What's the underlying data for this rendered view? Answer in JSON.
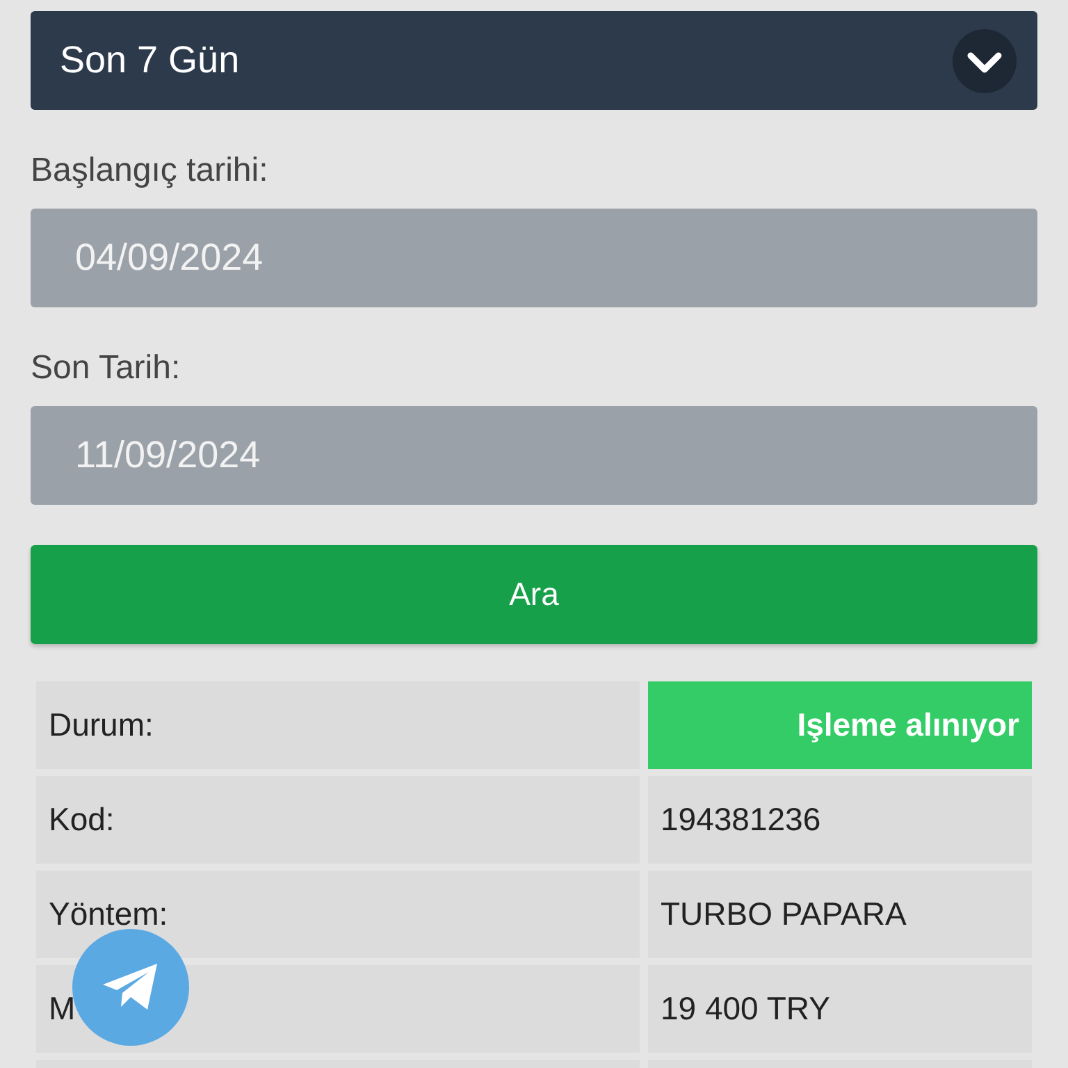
{
  "period_select": {
    "value": "Son 7 Gün"
  },
  "start_date": {
    "label": "Başlangıç tarihi:",
    "value": "04/09/2024"
  },
  "end_date": {
    "label": "Son Tarih:",
    "value": "11/09/2024"
  },
  "search_button": "Ara",
  "details": [
    {
      "label": "Durum:",
      "value": "Işleme alınıyor",
      "kind": "status"
    },
    {
      "label": "Kod:",
      "value": "194381236",
      "kind": "text"
    },
    {
      "label": "Yöntem:",
      "value": "TURBO PAPARA",
      "kind": "text"
    },
    {
      "label": "M",
      "value": "19 400 TRY",
      "kind": "text"
    }
  ]
}
